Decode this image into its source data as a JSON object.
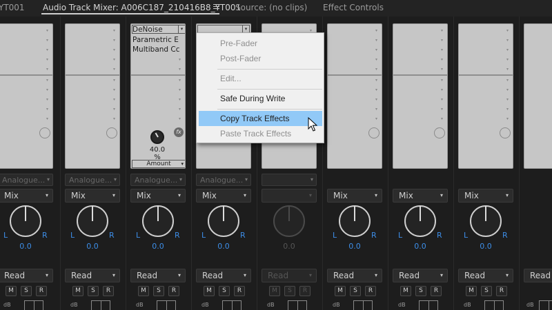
{
  "tabs": [
    {
      "label": "YT001"
    },
    {
      "label": "Audio Track Mixer: A006C187_210416B8_YT001",
      "active": true
    },
    {
      "label": "Source: (no clips)"
    },
    {
      "label": "Effect Controls"
    }
  ],
  "strips": [
    {
      "input": "Analogue...",
      "mode": "Mix",
      "pan": "0.0",
      "automation": "Read",
      "buttons": [
        "M",
        "S",
        "R"
      ],
      "db": "dB"
    },
    {
      "input": "Analogue...",
      "mode": "Mix",
      "pan": "0.0",
      "automation": "Read",
      "buttons": [
        "M",
        "S",
        "R"
      ],
      "db": "dB"
    },
    {
      "input": "Analogue...",
      "mode": "Mix",
      "pan": "0.0",
      "automation": "Read",
      "buttons": [
        "M",
        "S",
        "R"
      ],
      "db": "dB",
      "effects": [
        "DeNoise",
        "Parametric E",
        "Multiband Cc"
      ],
      "param_value": "40.0",
      "param_unit": "%",
      "param_name": "Amount"
    },
    {
      "input": "Analogue...",
      "mode": "Mix",
      "pan": "0.0",
      "automation": "Read",
      "buttons": [
        "M",
        "S",
        "R"
      ],
      "db": "dB"
    },
    {
      "input": "",
      "mode": "",
      "pan": "0.0",
      "automation": "Read",
      "buttons": [
        "M",
        "S",
        "R"
      ],
      "db": "dB",
      "disabled": true
    },
    {
      "input": "",
      "mode": "Mix",
      "pan": "0.0",
      "automation": "Read",
      "buttons": [
        "M",
        "S",
        "R"
      ],
      "db": "dB"
    },
    {
      "input": "",
      "mode": "Mix",
      "pan": "0.0",
      "automation": "Read",
      "buttons": [
        "M",
        "S",
        "R"
      ],
      "db": "dB"
    },
    {
      "input": "",
      "mode": "Mix",
      "pan": "0.0",
      "automation": "Read",
      "buttons": [
        "M",
        "S",
        "R"
      ],
      "db": "dB"
    },
    {
      "input": "",
      "mode": "",
      "pan": "",
      "automation": "Read",
      "buttons": [],
      "db": "dB"
    }
  ],
  "pan_labels": {
    "left": "L",
    "right": "R"
  },
  "context_menu": {
    "items": [
      {
        "label": "Pre-Fader",
        "enabled": false
      },
      {
        "label": "Post-Fader",
        "enabled": false
      },
      {
        "label": "Edit...",
        "enabled": false
      },
      {
        "label": "Safe During Write",
        "enabled": true
      },
      {
        "label": "Copy Track Effects",
        "enabled": true,
        "highlighted": true
      },
      {
        "label": "Paste Track Effects",
        "enabled": false
      }
    ]
  },
  "colors": {
    "accent": "#3d8ee8",
    "highlight": "#91c9f7"
  }
}
